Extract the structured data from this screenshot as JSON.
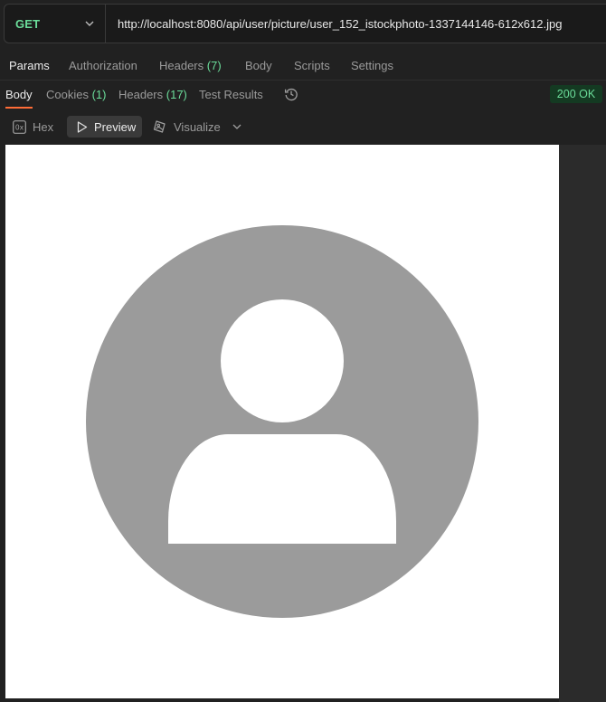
{
  "request": {
    "method": "GET",
    "url": "http://localhost:8080/api/user/picture/user_152_istockphoto-1337144146-612x612.jpg"
  },
  "request_tabs": [
    {
      "label": "Params"
    },
    {
      "label": "Authorization"
    },
    {
      "label": "Headers",
      "count": "(7)"
    },
    {
      "label": "Body"
    },
    {
      "label": "Scripts"
    },
    {
      "label": "Settings"
    }
  ],
  "response_tabs": [
    {
      "label": "Body"
    },
    {
      "label": "Cookies",
      "count": "(1)"
    },
    {
      "label": "Headers",
      "count": "(17)"
    },
    {
      "label": "Test Results"
    }
  ],
  "status": "200 OK",
  "view_modes": [
    {
      "label": "Hex",
      "icon": "hex-icon"
    },
    {
      "label": "Preview",
      "icon": "play-icon"
    },
    {
      "label": "Visualize",
      "icon": "visualize-icon"
    }
  ],
  "hex_icon_text": "0x",
  "preview": {
    "image": "default-user-avatar",
    "background": "#ffffff",
    "avatar_color": "#9b9b9b"
  },
  "colors": {
    "accent": "#ff6c37",
    "success": "#6bdd9a",
    "background": "#212121"
  }
}
